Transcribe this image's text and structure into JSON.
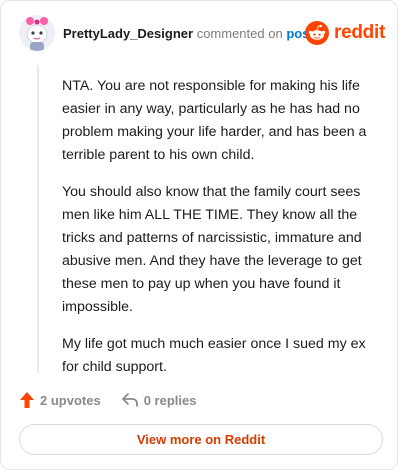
{
  "header": {
    "username": "PrettyLady_Designer",
    "commented_text": "commented on",
    "post_link": "post",
    "brand": "reddit"
  },
  "comment": {
    "paragraphs": [
      "NTA. You are not responsible for making his life easier in any way, particularly as he has had no problem making your life harder, and has been a terrible parent to his own child.",
      "You should also know that the family court sees men like him ALL THE TIME. They know all the tricks and patterns of narcissistic, immature and abusive men. And they have the leverage to get these men to pay up when you have found it impossible.",
      "My life got much much easier once I sued my ex for child support."
    ]
  },
  "actions": {
    "upvotes": "2 upvotes",
    "replies": "0 replies"
  },
  "footer": {
    "button_label": "View more on Reddit"
  },
  "colors": {
    "brand": "#ff4500",
    "link": "#0079d3",
    "button_text": "#d93a00"
  },
  "icons": [
    "avatar",
    "reddit-logo-icon",
    "upvote-arrow-icon",
    "reply-icon"
  ]
}
